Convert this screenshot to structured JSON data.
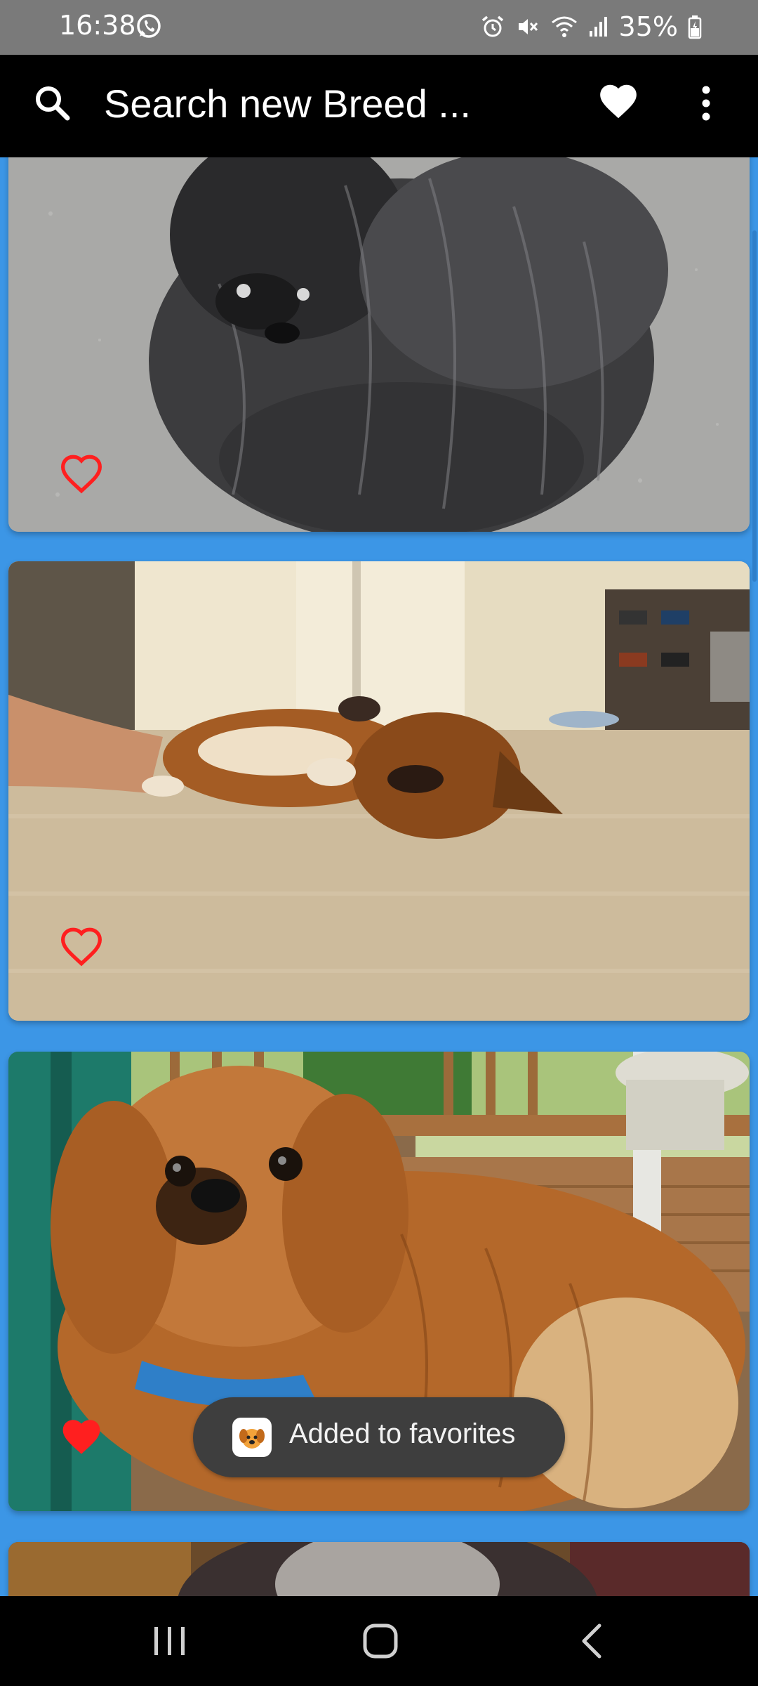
{
  "status_bar": {
    "time": "16:38",
    "battery": "35%"
  },
  "app_bar": {
    "title": "Search new Breed ...",
    "icons": [
      "search-icon",
      "heart-icon",
      "more-vert-icon"
    ]
  },
  "feed": {
    "cards": [
      {
        "favorite": false
      },
      {
        "favorite": false
      },
      {
        "favorite": true
      },
      {
        "favorite": false
      }
    ]
  },
  "toast": {
    "message": "Added to favorites"
  },
  "colors": {
    "feed_background": "#3c96e6",
    "app_bar": "#000000",
    "favorite_red": "#ff1f1f"
  }
}
